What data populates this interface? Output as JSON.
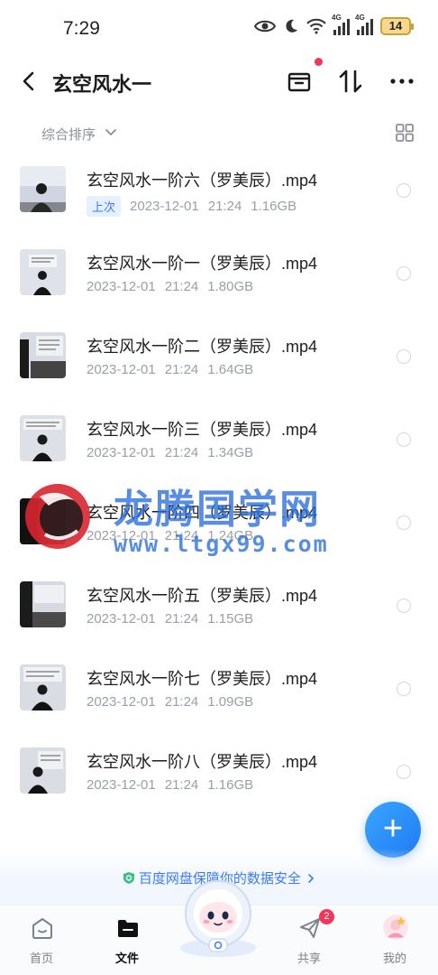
{
  "status_bar": {
    "time": "7:29",
    "battery": "14"
  },
  "header": {
    "title": "玄空风水一"
  },
  "sortbar": {
    "label": "综合排序"
  },
  "files": [
    {
      "name": "玄空风水一阶六（罗美辰）.mp4",
      "badge": "上次",
      "date": "2023-12-01",
      "time": "21:24",
      "size": "1.16GB"
    },
    {
      "name": "玄空风水一阶一（罗美辰）.mp4",
      "badge": "",
      "date": "2023-12-01",
      "time": "21:24",
      "size": "1.80GB"
    },
    {
      "name": "玄空风水一阶二（罗美辰）.mp4",
      "badge": "",
      "date": "2023-12-01",
      "time": "21:24",
      "size": "1.64GB"
    },
    {
      "name": "玄空风水一阶三（罗美辰）.mp4",
      "badge": "",
      "date": "2023-12-01",
      "time": "21:24",
      "size": "1.34GB"
    },
    {
      "name": "玄空风水一阶四（罗美辰）.mp4",
      "badge": "",
      "date": "2023-12-01",
      "time": "21:24",
      "size": "1.24GB"
    },
    {
      "name": "玄空风水一阶五（罗美辰）.mp4",
      "badge": "",
      "date": "2023-12-01",
      "time": "21:24",
      "size": "1.15GB"
    },
    {
      "name": "玄空风水一阶七（罗美辰）.mp4",
      "badge": "",
      "date": "2023-12-01",
      "time": "21:24",
      "size": "1.09GB"
    },
    {
      "name": "玄空风水一阶八（罗美辰）.mp4",
      "badge": "",
      "date": "2023-12-01",
      "time": "21:24",
      "size": "1.16GB"
    }
  ],
  "watermark": {
    "title": "龙腾国学网",
    "url": "www.ltgx99.com"
  },
  "safety_banner": {
    "text": "百度网盘保障你的数据安全"
  },
  "bottom_nav": {
    "home": "首页",
    "files": "文件",
    "share": "共享",
    "share_badge": "2",
    "me": "我的"
  },
  "colors": {
    "accent": "#3b7bf6",
    "badge_red": "#f2355b",
    "fab": "#1f7bf2"
  }
}
